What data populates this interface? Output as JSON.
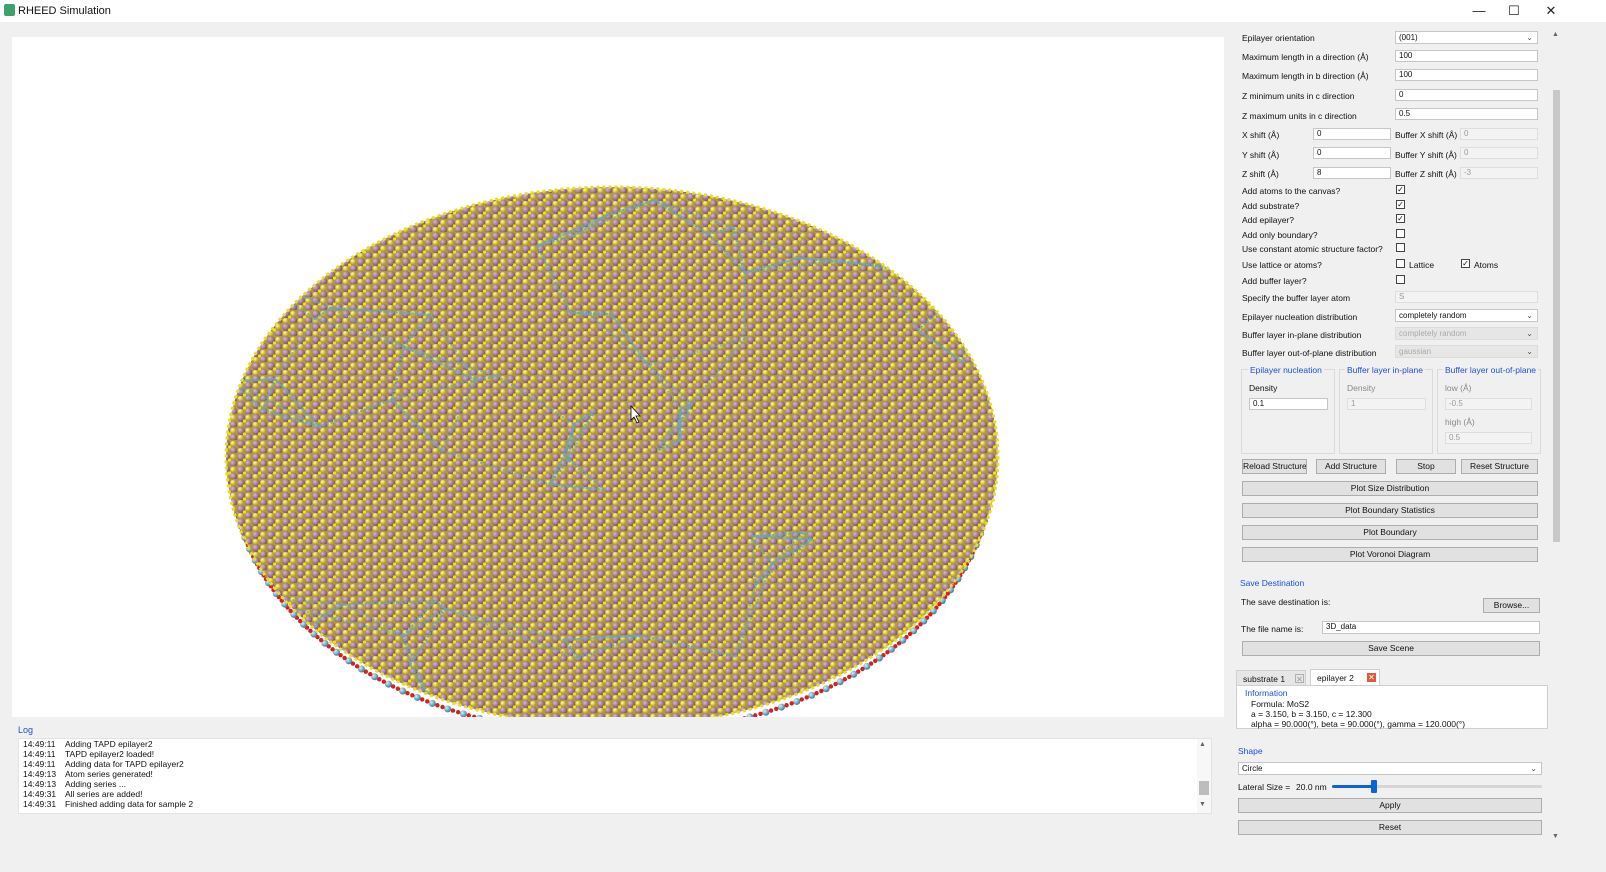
{
  "window": {
    "title": "RHEED Simulation",
    "minimize": "—",
    "maximize": "☐",
    "close": "✕"
  },
  "log": {
    "title": "Log",
    "entries": [
      {
        "time": "14:49:11",
        "text": "Adding TAPD epilayer2"
      },
      {
        "time": "14:49:11",
        "text": "TAPD epilayer2 loaded!"
      },
      {
        "time": "14:49:11",
        "text": "Adding data for TAPD epilayer2"
      },
      {
        "time": "14:49:13",
        "text": "Atom series generated!"
      },
      {
        "time": "14:49:13",
        "text": "Adding series ..."
      },
      {
        "time": "14:49:31",
        "text": "All series are added!"
      },
      {
        "time": "14:49:31",
        "text": "Finished adding data for sample 2"
      }
    ]
  },
  "settings": {
    "epilayer_orientation_label": "Epilayer orientation",
    "epilayer_orientation_value": "(001)",
    "max_len_a_label": "Maximum length in a direction (Å)",
    "max_len_a_value": "100",
    "max_len_b_label": "Maximum length in b direction (Å)",
    "max_len_b_value": "100",
    "z_min_label": "Z minimum units in c direction",
    "z_min_value": "0",
    "z_max_label": "Z maximum units in c direction",
    "z_max_value": "0.5",
    "x_shift_label": "X shift (Å)",
    "x_shift_value": "0",
    "y_shift_label": "Y shift (Å)",
    "y_shift_value": "0",
    "z_shift_label": "Z shift (Å)",
    "z_shift_value": "8",
    "buffer_x_label": "Buffer X shift (Å)",
    "buffer_x_value": "0",
    "buffer_y_label": "Buffer Y shift (Å)",
    "buffer_y_value": "0",
    "buffer_z_label": "Buffer Z shift (Å)",
    "buffer_z_value": "-3",
    "add_atoms_label": "Add atoms to the canvas?",
    "add_atoms_checked": true,
    "add_substrate_label": "Add substrate?",
    "add_substrate_checked": true,
    "add_epilayer_label": "Add epilayer?",
    "add_epilayer_checked": true,
    "add_boundary_label": "Add only boundary?",
    "add_boundary_checked": false,
    "constant_factor_label": "Use constant atomic structure factor?",
    "constant_factor_checked": false,
    "lattice_or_atoms_label": "Use lattice or atoms?",
    "lattice_label": "Lattice",
    "lattice_checked": false,
    "atoms_label": "Atoms",
    "atoms_checked": true,
    "add_buffer_label": "Add buffer layer?",
    "add_buffer_checked": false,
    "buffer_atom_label": "Specify the buffer layer atom",
    "buffer_atom_value": "S",
    "epi_nucleation_dist_label": "Epilayer nucleation distribution",
    "epi_nucleation_dist_value": "completely random",
    "buffer_inplane_dist_label": "Buffer layer in-plane distribution",
    "buffer_inplane_dist_value": "completely random",
    "buffer_outplane_dist_label": "Buffer layer out-of-plane distribution",
    "buffer_outplane_dist_value": "gaussian"
  },
  "groups": {
    "epi_nucleation_title": "Epilayer nucleation",
    "epi_density_label": "Density",
    "epi_density_value": "0.1",
    "buffer_inplane_title": "Buffer layer in-plane",
    "buffer_density_label": "Density",
    "buffer_density_value": "1",
    "buffer_outplane_title": "Buffer layer out-of-plane",
    "low_label": "low (Å)",
    "low_value": "-0.5",
    "high_label": "high (Å)",
    "high_value": "0.5"
  },
  "actions": {
    "reload": "Reload Structure",
    "add": "Add Structure",
    "stop": "Stop",
    "reset": "Reset Structure",
    "plot_size": "Plot Size Distribution",
    "plot_boundary_stats": "Plot Boundary Statistics",
    "plot_boundary": "Plot Boundary",
    "plot_voronoi": "Plot Voronoi Diagram"
  },
  "save": {
    "section_title": "Save Destination",
    "dest_label": "The save destination is:",
    "browse": "Browse...",
    "filename_label": "The file name is:",
    "filename_value": "3D_data",
    "save_scene": "Save Scene"
  },
  "tabs": [
    {
      "label": "substrate 1",
      "close": "✕",
      "active": false
    },
    {
      "label": "epilayer 2",
      "close": "✕",
      "active": true
    }
  ],
  "info": {
    "title": "Information",
    "formula": "Formula: MoS2",
    "abc": "a = 3.150, b = 3.150, c = 12.300",
    "angles": "alpha = 90.000(°), beta = 90.000(°), gamma = 120.000(°)"
  },
  "shape": {
    "title": "Shape",
    "value": "Circle",
    "lateral_label": "Lateral Size =",
    "lateral_value": "20.0 nm",
    "lateral_fraction": 0.2,
    "apply": "Apply",
    "reset": "Reset"
  },
  "colors": {
    "accent": "#1a4fd6",
    "molybdenum": "#9e6b8f",
    "sulfur": "#e5d800",
    "substrate_blue": "#5fa1bd",
    "substrate_red": "#d42020"
  }
}
